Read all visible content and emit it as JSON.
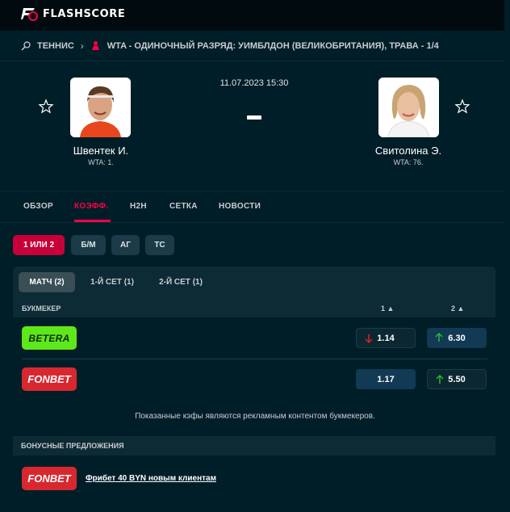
{
  "app": {
    "logo_text": "FLASHSCORE"
  },
  "breadcrumb": {
    "sport": "ТЕННИС",
    "tournament": "WTA - ОДИНОЧНЫЙ РАЗРЯД: УИМБЛДОН (ВЕЛИКОБРИТАНИЯ), ТРАВА - 1/4"
  },
  "match": {
    "datetime": "11.07.2023 15:30",
    "home": {
      "name": "Швентек И.",
      "rank": "WTA: 1."
    },
    "away": {
      "name": "Свитолина Э.",
      "rank": "WTA: 76."
    }
  },
  "tabs": [
    {
      "label": "ОБЗОР"
    },
    {
      "label": "КОЭФФ.",
      "active": true
    },
    {
      "label": "H2H"
    },
    {
      "label": "СЕТКА"
    },
    {
      "label": "НОВОСТИ"
    }
  ],
  "bet_types": [
    {
      "label": "1 ИЛИ 2",
      "active": true
    },
    {
      "label": "Б/М"
    },
    {
      "label": "АГ"
    },
    {
      "label": "ТС"
    }
  ],
  "periods": [
    {
      "label": "МАТЧ (2)",
      "active": true
    },
    {
      "label": "1-Й СЕТ (1)"
    },
    {
      "label": "2-Й СЕТ (1)"
    }
  ],
  "odds_table": {
    "header": {
      "bookmaker": "БУКМЕКЕР",
      "col1": "1 ▲",
      "col2": "2 ▲"
    },
    "rows": [
      {
        "bookmaker": "BETERA",
        "odd1": "1.14",
        "odd1_trend": "down",
        "odd2": "6.30",
        "odd2_trend": "up"
      },
      {
        "bookmaker": "FONBET",
        "odd1": "1.17",
        "odd1_trend": "none",
        "odd2": "5.50",
        "odd2_trend": "up"
      }
    ]
  },
  "disclaimer": "Показанные кэфы являются рекламным контентом букмекеров.",
  "bonus": {
    "title": "БОНУСНЫЕ ПРЕДЛОЖЕНИЯ",
    "bookmaker": "FONBET",
    "text": "Фрибет 40 BYN новым клиентам"
  },
  "colors": {
    "accent": "#ff0046",
    "background": "#001e28",
    "betera": "#5ee81a",
    "fonbet": "#d8282f",
    "up": "#1fbf2f",
    "down": "#e02020"
  }
}
